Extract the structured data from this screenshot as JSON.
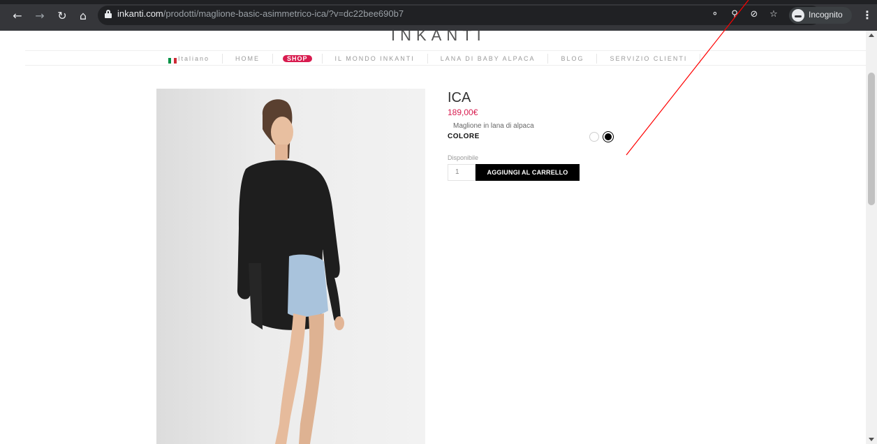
{
  "browser": {
    "url_host": "inkanti.com",
    "url_path": "/prodotti/maglione-basic-asimmetrico-ica/?v=dc22bee690b7",
    "incognito_label": "Incognito",
    "icons": [
      "back-icon",
      "forward-icon",
      "reload-icon",
      "home-icon",
      "lock-icon",
      "key-icon",
      "zoom-icon",
      "eye-off-icon",
      "star-icon",
      "incognito-icon",
      "menu-icon"
    ]
  },
  "site": {
    "logo": "INKANTI"
  },
  "nav": {
    "language": "Italiano",
    "items": [
      "HOME",
      "SHOP",
      "IL MONDO INKANTI",
      "LANA DI BABY ALPACA",
      "BLOG",
      "SERVIZIO CLIENTI"
    ]
  },
  "product": {
    "title": "ICA",
    "price": "189,00€",
    "description": "Maglione in lana di alpaca",
    "color_label": "COLORE",
    "colors": [
      "#ffffff",
      "#000000"
    ],
    "availability": "Disponibile",
    "quantity": "1",
    "add_to_cart": "AGGIUNGI AL CARRELLO"
  },
  "colors": {
    "accent": "#d81c4f",
    "annotation": "#ff0000"
  }
}
